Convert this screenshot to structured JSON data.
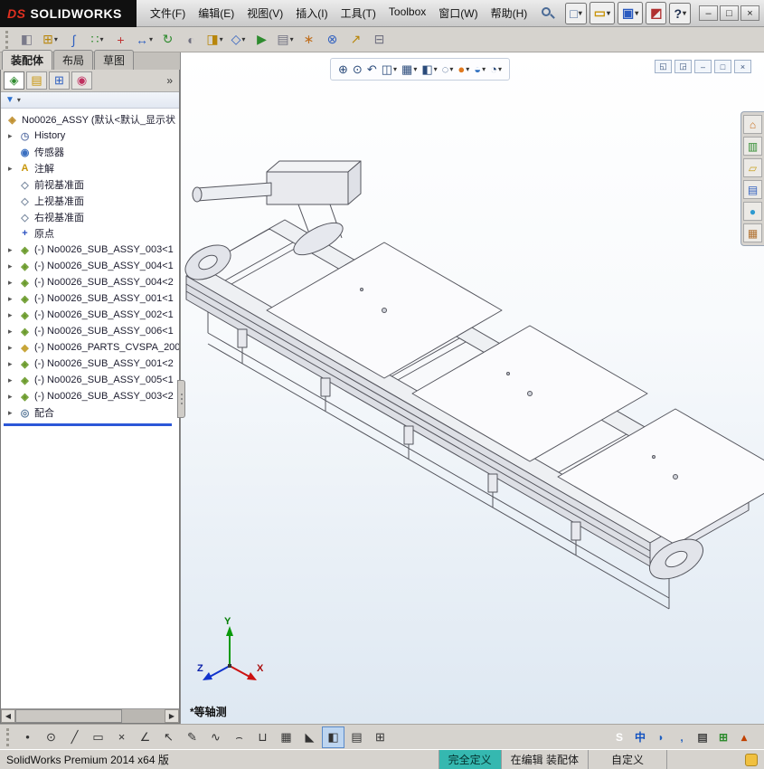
{
  "title_bar": {
    "logo_mark": "DS",
    "logo_text": "SOLIDWORKS",
    "menus": [
      "文件(F)",
      "编辑(E)",
      "视图(V)",
      "插入(I)",
      "工具(T)",
      "Toolbox",
      "窗口(W)",
      "帮助(H)"
    ],
    "quick_icons": [
      {
        "name": "new-document-icon",
        "glyph": "□",
        "color": "#4a6a9a",
        "caret": "▾"
      },
      {
        "name": "open-document-icon",
        "glyph": "▭",
        "color": "#c8940a",
        "caret": "▾"
      },
      {
        "name": "save-icon",
        "glyph": "▣",
        "color": "#2a5ac0",
        "caret": "▾"
      },
      {
        "name": "rebuild-icon",
        "glyph": "◩",
        "color": "#b03030"
      },
      {
        "name": "options-icon",
        "glyph": "?",
        "color": "#203050",
        "caret": "▾"
      }
    ],
    "window_buttons": [
      {
        "name": "minimize-button",
        "glyph": "–"
      },
      {
        "name": "maximize-button",
        "glyph": "□"
      },
      {
        "name": "close-button",
        "glyph": "×"
      }
    ]
  },
  "toolbar": {
    "icons": [
      {
        "name": "edit-component-icon",
        "glyph": "◧",
        "color": "#7a7a8a"
      },
      {
        "name": "insert-components-icon",
        "glyph": "⊞",
        "color": "#b8860b",
        "caret": "▾"
      },
      {
        "name": "mate-icon",
        "glyph": "∫",
        "color": "#3060c0"
      },
      {
        "name": "linear-component-pattern-icon",
        "glyph": "∷",
        "color": "#2e8b2e",
        "caret": "▾"
      },
      {
        "name": "smart-fasteners-icon",
        "glyph": "+",
        "color": "#c03030"
      },
      {
        "name": "move-component-icon",
        "glyph": "↔",
        "color": "#3060c0",
        "caret": "▾"
      },
      {
        "name": "rotate-component-icon",
        "glyph": "↻",
        "color": "#2e8b2e"
      },
      {
        "name": "show-hidden-components-icon",
        "glyph": "◐",
        "color": "#707080"
      },
      {
        "name": "assembly-features-icon",
        "glyph": "◨",
        "color": "#b8860b",
        "caret": "▾"
      },
      {
        "name": "reference-geometry-icon",
        "glyph": "◇",
        "color": "#3060c0",
        "caret": "▾"
      },
      {
        "name": "new-motion-study-icon",
        "glyph": "▶",
        "color": "#2e8b2e"
      },
      {
        "name": "bill-of-materials-icon",
        "glyph": "▤",
        "color": "#707080",
        "caret": "▾"
      },
      {
        "name": "exploded-view-icon",
        "glyph": "∗",
        "color": "#c07020"
      },
      {
        "name": "interference-detection-icon",
        "glyph": "⊗",
        "color": "#3060c0"
      },
      {
        "name": "measure-icon",
        "glyph": "↗",
        "color": "#b8860b"
      },
      {
        "name": "section-view-tool-icon",
        "glyph": "⊟",
        "color": "#707080"
      }
    ]
  },
  "mode_tabs": {
    "tabs": [
      {
        "name": "tab-assembly",
        "label": "装配体",
        "active": true
      },
      {
        "name": "tab-layout",
        "label": "布局"
      },
      {
        "name": "tab-sketch",
        "label": "草图"
      }
    ]
  },
  "panel": {
    "tabs": [
      {
        "name": "featuremanager-tab",
        "glyph": "◈",
        "color": "#2e8b2e",
        "active": true
      },
      {
        "name": "propertymanager-tab",
        "glyph": "▤",
        "color": "#c8940a"
      },
      {
        "name": "configurationmanager-tab",
        "glyph": "⊞",
        "color": "#3060c0"
      },
      {
        "name": "dimxpertmanager-tab",
        "glyph": "◉",
        "color": "#c03060"
      }
    ],
    "chevron": "»",
    "filter": {
      "funnel_glyph": "▼",
      "caret": "▾"
    },
    "tree": {
      "root": {
        "icon_glyph": "◈",
        "label": "No0026_ASSY (默认<默认_显示状"
      },
      "items": [
        {
          "name": "tree-item-history",
          "icon_name": "history-folder-icon",
          "icon_glyph": "◷",
          "icon_color": "#6a7fae",
          "expand": "▸",
          "label": "History"
        },
        {
          "name": "tree-item-sensors",
          "icon_name": "sensors-icon",
          "icon_glyph": "◉",
          "icon_color": "#3a6fc0",
          "label": "传感器"
        },
        {
          "name": "tree-item-annotations",
          "icon_name": "annotations-icon",
          "icon_glyph": "A",
          "icon_color": "#c8960a",
          "expand": "▸",
          "label": "注解"
        },
        {
          "name": "tree-item-front-plane",
          "icon_name": "plane-icon",
          "icon_glyph": "◇",
          "icon_color": "#7a8aa0",
          "label": "前视基准面"
        },
        {
          "name": "tree-item-top-plane",
          "icon_name": "plane-icon",
          "icon_glyph": "◇",
          "icon_color": "#7a8aa0",
          "label": "上视基准面"
        },
        {
          "name": "tree-item-right-plane",
          "icon_name": "plane-icon",
          "icon_glyph": "◇",
          "icon_color": "#7a8aa0",
          "label": "右视基准面"
        },
        {
          "name": "tree-item-origin",
          "icon_name": "origin-icon",
          "icon_glyph": "+",
          "icon_color": "#2a50c0",
          "label": "原点"
        },
        {
          "name": "tree-item-sub-assy-003-1",
          "icon_name": "subassembly-icon",
          "icon_glyph": "◈",
          "icon_color": "#6a9a2a",
          "expand": "▸",
          "label": "(-) No0026_SUB_ASSY_003<1"
        },
        {
          "name": "tree-item-sub-assy-004-1",
          "icon_name": "subassembly-icon",
          "icon_glyph": "◈",
          "icon_color": "#6a9a2a",
          "expand": "▸",
          "label": "(-) No0026_SUB_ASSY_004<1"
        },
        {
          "name": "tree-item-sub-assy-004-2",
          "icon_name": "subassembly-icon",
          "icon_glyph": "◈",
          "icon_color": "#6a9a2a",
          "expand": "▸",
          "label": "(-) No0026_SUB_ASSY_004<2"
        },
        {
          "name": "tree-item-sub-assy-001-1",
          "icon_name": "subassembly-icon",
          "icon_glyph": "◈",
          "icon_color": "#6a9a2a",
          "expand": "▸",
          "label": "(-) No0026_SUB_ASSY_001<1"
        },
        {
          "name": "tree-item-sub-assy-002-1",
          "icon_name": "subassembly-icon",
          "icon_glyph": "◈",
          "icon_color": "#6a9a2a",
          "expand": "▸",
          "label": "(-) No0026_SUB_ASSY_002<1"
        },
        {
          "name": "tree-item-sub-assy-006-1",
          "icon_name": "subassembly-icon",
          "icon_glyph": "◈",
          "icon_color": "#6a9a2a",
          "expand": "▸",
          "label": "(-) No0026_SUB_ASSY_006<1"
        },
        {
          "name": "tree-item-parts-cvspa-200",
          "icon_name": "part-icon",
          "icon_glyph": "◆",
          "icon_color": "#c8a63a",
          "expand": "▸",
          "label": "(-) No0026_PARTS_CVSPA_200"
        },
        {
          "name": "tree-item-sub-assy-001-2",
          "icon_name": "subassembly-icon",
          "icon_glyph": "◈",
          "icon_color": "#6a9a2a",
          "expand": "▸",
          "label": "(-) No0026_SUB_ASSY_001<2"
        },
        {
          "name": "tree-item-sub-assy-005-1",
          "icon_name": "subassembly-icon",
          "icon_glyph": "◈",
          "icon_color": "#6a9a2a",
          "expand": "▸",
          "label": "(-) No0026_SUB_ASSY_005<1"
        },
        {
          "name": "tree-item-sub-assy-003-2",
          "icon_name": "subassembly-icon",
          "icon_glyph": "◈",
          "icon_color": "#6a9a2a",
          "expand": "▸",
          "label": "(-) No0026_SUB_ASSY_003<2"
        },
        {
          "name": "tree-item-mates",
          "icon_name": "mates-folder-icon",
          "icon_glyph": "◎",
          "icon_color": "#5a7a9a",
          "expand": "▸",
          "label": "配合"
        }
      ]
    }
  },
  "viewport": {
    "heads_up": [
      {
        "name": "zoom-fit-icon",
        "glyph": "⊕"
      },
      {
        "name": "zoom-area-icon",
        "glyph": "⊙"
      },
      {
        "name": "previous-view-icon",
        "glyph": "↶"
      },
      {
        "name": "section-view-icon",
        "glyph": "◫",
        "caret": "▾"
      },
      {
        "name": "view-orientation-icon",
        "glyph": "▦",
        "caret": "▾"
      },
      {
        "name": "display-style-icon",
        "glyph": "◧",
        "caret": "▾"
      },
      {
        "name": "hide-show-items-icon",
        "glyph": "◌",
        "caret": "▾"
      },
      {
        "name": "edit-appearance-icon",
        "glyph": "●",
        "color": "#e07a20",
        "caret": "▾"
      },
      {
        "name": "apply-scene-icon",
        "glyph": "◒",
        "color": "#3070c0",
        "caret": "▾"
      },
      {
        "name": "view-settings-icon",
        "glyph": "◔",
        "caret": "▾"
      }
    ],
    "doc_controls": [
      {
        "name": "window-previous-icon",
        "glyph": "◱"
      },
      {
        "name": "window-next-icon",
        "glyph": "◲"
      },
      {
        "name": "window-minimize-icon",
        "glyph": "–"
      },
      {
        "name": "window-restore-icon",
        "glyph": "□"
      },
      {
        "name": "window-close-icon",
        "glyph": "×"
      }
    ],
    "view_label": "*等轴测",
    "triad": {
      "x": "X",
      "y": "Y",
      "z": "Z"
    }
  },
  "task_pane": {
    "icons": [
      {
        "name": "solidworks-resources-icon",
        "glyph": "⌂",
        "color": "#c87020"
      },
      {
        "name": "design-library-icon",
        "glyph": "▥",
        "color": "#2e8b2e"
      },
      {
        "name": "file-explorer-icon",
        "glyph": "▱",
        "color": "#c8a020"
      },
      {
        "name": "view-palette-icon",
        "glyph": "▤",
        "color": "#3060c0"
      },
      {
        "name": "appearances-icon",
        "glyph": "●",
        "color": "#2e9ad0"
      },
      {
        "name": "custom-properties-icon",
        "glyph": "▦",
        "color": "#b07030"
      }
    ]
  },
  "sketch_bar": {
    "icons": [
      {
        "name": "select-icon",
        "glyph": "•"
      },
      {
        "name": "circle-tool-icon",
        "glyph": "⊙"
      },
      {
        "name": "line-tool-icon",
        "glyph": "╱"
      },
      {
        "name": "rectangle-tool-icon",
        "glyph": "▭"
      },
      {
        "name": "trim-icon",
        "glyph": "×"
      },
      {
        "name": "angle-dimension-icon",
        "glyph": "∠"
      },
      {
        "name": "pointer-icon",
        "glyph": "↖"
      },
      {
        "name": "sketch-icon",
        "glyph": "✎"
      },
      {
        "name": "spline-icon",
        "glyph": "∿"
      },
      {
        "name": "arc-icon",
        "glyph": "⌢"
      },
      {
        "name": "slot-icon",
        "glyph": "⊔"
      },
      {
        "name": "grid-icon",
        "glyph": "▦"
      },
      {
        "name": "polygon-icon",
        "glyph": "◣"
      },
      {
        "name": "shaded-display-icon",
        "glyph": "◧",
        "active": true
      },
      {
        "name": "section-display-icon",
        "glyph": "▤"
      },
      {
        "name": "viewport-split-icon",
        "glyph": "⊞"
      }
    ]
  },
  "lang_tray": {
    "icons": [
      {
        "name": "sogou-pinyin-icon",
        "glyph": "S",
        "fg": "#ffffff",
        "bg": "#e8601a",
        "round": true
      },
      {
        "name": "ime-chinese-icon",
        "glyph": "中",
        "fg": "#1050c0"
      },
      {
        "name": "ime-halfwidth-icon",
        "glyph": "◗",
        "fg": "#2060c0"
      },
      {
        "name": "ime-punctuation-icon",
        "glyph": ",",
        "fg": "#2060c0"
      },
      {
        "name": "ime-softkeyboard-icon",
        "glyph": "▤",
        "fg": "#404040"
      },
      {
        "name": "ime-toolbox-icon",
        "glyph": "⊞",
        "fg": "#2e8b2e"
      },
      {
        "name": "tray-collapse-icon",
        "glyph": "▴",
        "fg": "#c04000"
      }
    ]
  },
  "status_bar": {
    "product": "SolidWorks Premium 2014 x64 版",
    "define_state": "完全定义",
    "edit_state": "在编辑 装配体",
    "custom": "自定义"
  }
}
